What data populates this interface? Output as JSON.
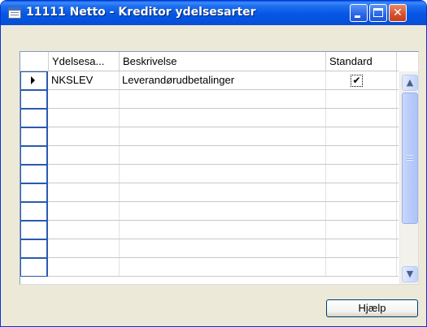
{
  "window": {
    "title": "11111 Netto - Kreditor ydelsesarter",
    "icon": "form-window-icon",
    "buttons": {
      "minimize": "minimize",
      "maximize": "maximize",
      "close": "✕"
    }
  },
  "table": {
    "columns": [
      "Ydelsesa...",
      "Beskrivelse",
      "Standard"
    ],
    "rows": [
      {
        "code": "NKSLEV",
        "description": "Leverandørudbetalinger",
        "standard": "✔",
        "selected": true
      }
    ],
    "empty_row_count": 10
  },
  "scrollbar": {
    "up": "▲",
    "down": "▼"
  },
  "footer": {
    "help_label": "Hjælp"
  },
  "colors": {
    "titlebar": "#0556e4",
    "window_bg": "#ece9d8",
    "close_button": "#d6502e"
  }
}
